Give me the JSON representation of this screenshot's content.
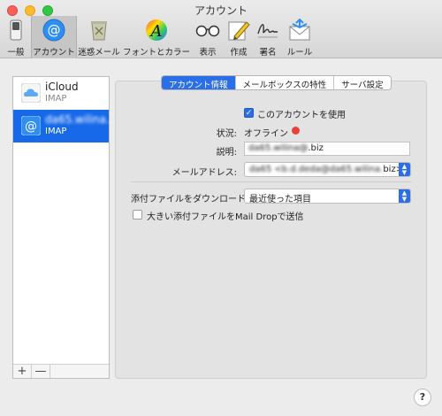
{
  "window": {
    "title": "アカウント"
  },
  "toolbar": {
    "items": [
      {
        "label": "一般",
        "icon": "switch-icon"
      },
      {
        "label": "アカウント",
        "icon": "at-sign-icon",
        "selected": true
      },
      {
        "label": "迷惑メール",
        "icon": "junk-trash-icon"
      },
      {
        "label": "フォントとカラー",
        "icon": "font-color-icon"
      },
      {
        "label": "表示",
        "icon": "glasses-icon"
      },
      {
        "label": "作成",
        "icon": "compose-pencil-icon"
      },
      {
        "label": "署名",
        "icon": "signature-icon"
      },
      {
        "label": "ルール",
        "icon": "rules-envelope-icon"
      }
    ]
  },
  "sidebar": {
    "accounts": [
      {
        "name": "iCloud",
        "type": "IMAP",
        "icon": "cloud-icon",
        "selected": false
      },
      {
        "name": "da65.wilina...",
        "type": "IMAP",
        "icon": "at-sign-icon",
        "selected": true
      }
    ],
    "add_label": "+",
    "remove_label": "—"
  },
  "tabs": [
    {
      "label": "アカウント情報",
      "active": true
    },
    {
      "label": "メールボックスの特性",
      "active": false
    },
    {
      "label": "サーバ設定",
      "active": false
    }
  ],
  "form": {
    "enable_account_label": "このアカウントを使用",
    "enable_account_checked": true,
    "status_label": "状況:",
    "status_value": "オフライン",
    "status_color": "#e8413a",
    "description_label": "説明:",
    "description_prefix": "da65.wilina@",
    "description_suffix": ".biz",
    "email_label": "メールアドレス:",
    "email_prefix": "da65 <b.d.deda@da65.wilina.",
    "email_suffix": "biz>",
    "attachments_label": "添付ファイルをダウンロード:",
    "attachments_value": "最近使った項目",
    "maildrop_label": "大きい添付ファイルをMail Dropで送信",
    "maildrop_checked": false
  },
  "help_label": "?",
  "colors": {
    "accent": "#2a6fe8",
    "selection": "#1769ea"
  }
}
